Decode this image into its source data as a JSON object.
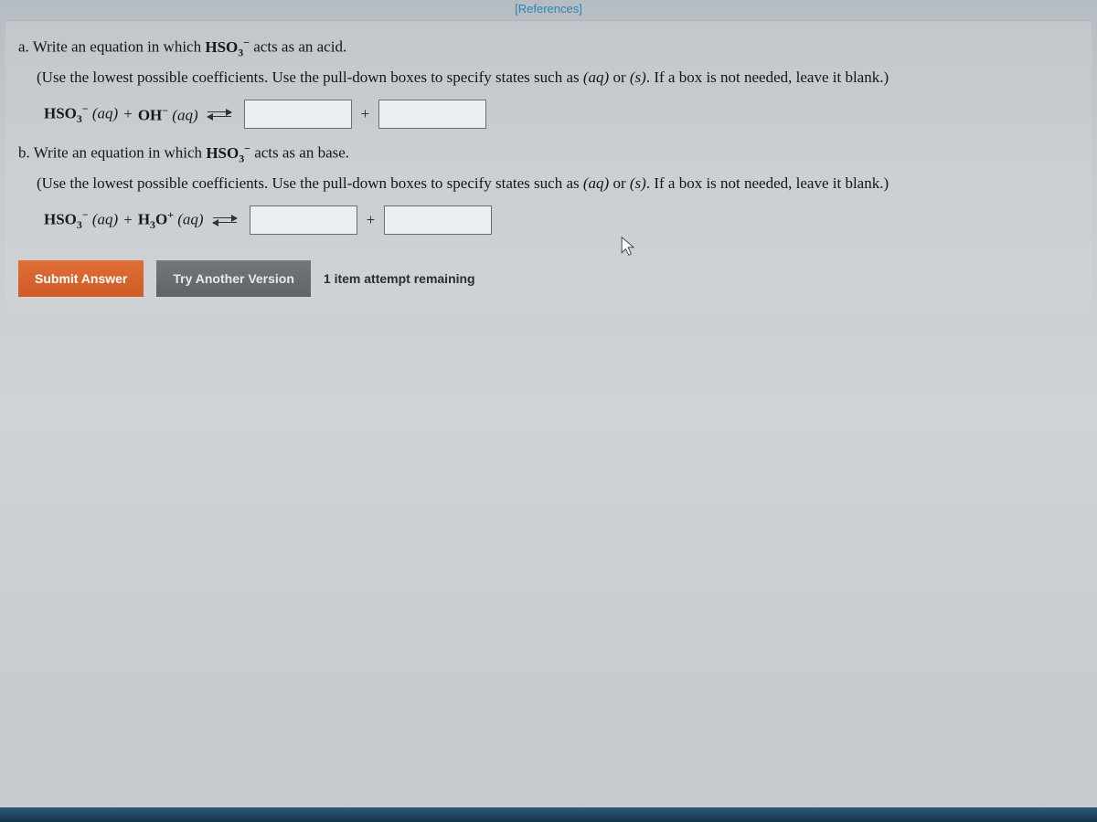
{
  "header": {
    "references_label": "[References]"
  },
  "part_a": {
    "prompt_prefix": "a. Write an equation in which ",
    "species_html": "HSO3⁻",
    "prompt_suffix": " acts as an acid.",
    "instructions_pre": "(Use the lowest possible coefficients. Use the pull-down boxes to specify states such as ",
    "instructions_ex1": "(aq)",
    "instructions_mid": " or ",
    "instructions_ex2": "(s)",
    "instructions_post": ". If a box is not needed, leave it blank.)",
    "lhs_term1": "HSO",
    "lhs_term1_sub": "3",
    "lhs_term1_sup": "−",
    "lhs_state1": "(aq)",
    "plus": "+",
    "lhs_term2": "OH",
    "lhs_term2_sup": "−",
    "lhs_state2": "(aq)"
  },
  "part_b": {
    "prompt_prefix": "b. Write an equation in which ",
    "species_html": "HSO3⁻",
    "prompt_suffix": " acts as an base.",
    "instructions_pre": "(Use the lowest possible coefficients. Use the pull-down boxes to specify states such as ",
    "instructions_ex1": "(aq)",
    "instructions_mid": " or ",
    "instructions_ex2": "(s)",
    "instructions_post": ". If a box is not needed, leave it blank.)",
    "lhs_term1": "HSO",
    "lhs_term1_sub": "3",
    "lhs_term1_sup": "−",
    "lhs_state1": "(aq)",
    "plus": "+",
    "lhs_term2": "H",
    "lhs_term2_sub": "3",
    "lhs_term2_mid": "O",
    "lhs_term2_sup": "+",
    "lhs_state2": "(aq)"
  },
  "buttons": {
    "submit": "Submit Answer",
    "try_another": "Try Another Version"
  },
  "status": {
    "attempts_remaining": "1 item attempt remaining"
  }
}
